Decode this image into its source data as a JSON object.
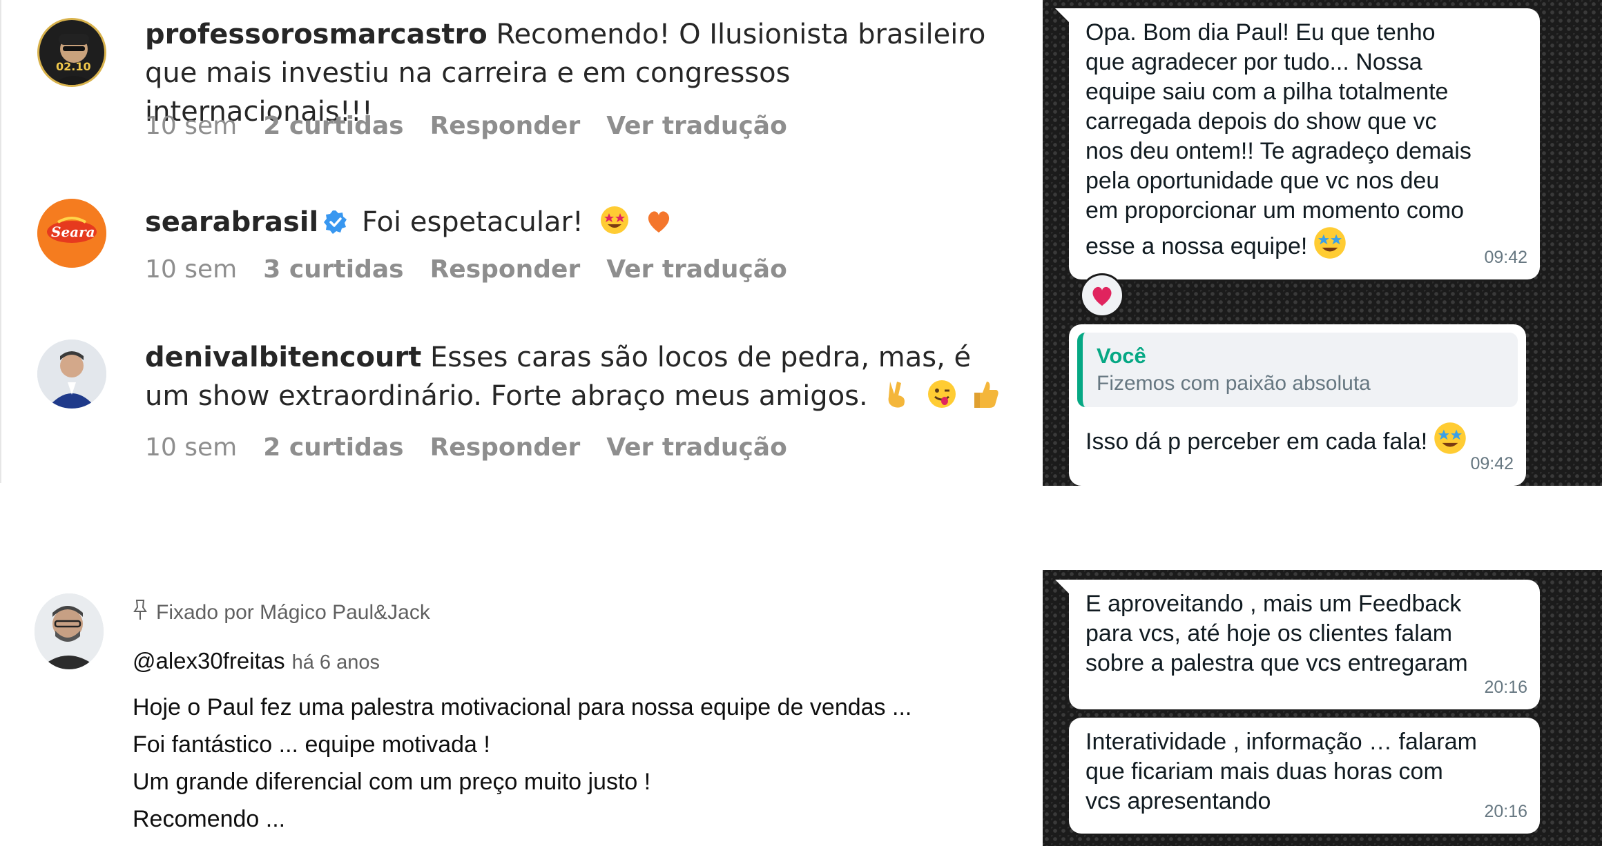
{
  "instagram": {
    "comments": [
      {
        "user": "professorosmarcastro",
        "text": "Recomendo! O Ilusionista brasileiro que mais investiu na carreira e em congressos internacionais!!!",
        "avatar_label": "02.10",
        "time": "10 sem",
        "likes": "2 curtidas",
        "reply": "Responder",
        "translate": "Ver tradução"
      },
      {
        "user": "searabrasil",
        "verified_icon": "verified-badge-icon",
        "text": "Foi espetacular!",
        "avatar_label": "Seara",
        "emojis": [
          "star-struck-emoji",
          "orange-heart-emoji"
        ],
        "time": "10 sem",
        "likes": "3 curtidas",
        "reply": "Responder",
        "translate": "Ver tradução"
      },
      {
        "user": "denivalbitencourt",
        "text": "Esses caras são locos de pedra, mas, é um show extraordinário. Forte abraço meus amigos.",
        "emojis": [
          "victory-hand-emoji",
          "winking-tongue-emoji",
          "thumbs-up-emoji"
        ],
        "time": "10 sem",
        "likes": "2 curtidas",
        "reply": "Responder",
        "translate": "Ver tradução"
      }
    ]
  },
  "youtube": {
    "pinned_label": "Fixado por Mágico Paul&Jack",
    "pin_icon": "pin-icon",
    "user": "@alex30freitas",
    "time": "há 6 anos",
    "lines": [
      "Hoje o Paul fez uma palestra motivacional para nossa equipe de vendas ...",
      "Foi fantástico ... equipe motivada !",
      "Um grande diferencial com um preço muito justo !",
      "Recomendo ..."
    ]
  },
  "whatsapp_top": {
    "message1": {
      "lines": [
        "Opa. Bom dia Paul! Eu que tenho",
        "que agradecer por tudo... Nossa",
        "equipe saiu com a pilha totalmente",
        "carregada depois do show que vc",
        "nos deu ontem!! Te agradeço demais",
        "pela oportunidade que vc nos deu",
        "em proporcionar um momento como",
        "esse a nossa equipe!"
      ],
      "time": "09:42",
      "reaction": "red-heart-emoji"
    },
    "message2": {
      "quote_name": "Você",
      "quote_text": "Fizemos com paixão absoluta",
      "text": "Isso dá p perceber em cada fala!",
      "time": "09:42"
    }
  },
  "whatsapp_bottom": {
    "message1": {
      "lines": [
        "E aproveitando , mais um Feedback",
        "para vcs, até hoje os clientes falam",
        "sobre a palestra que vcs entregaram"
      ],
      "time": "20:16"
    },
    "message2": {
      "lines": [
        "Interatividade , informação … falaram",
        "que ficariam mais duas horas com",
        "vcs apresentando"
      ],
      "time": "20:16"
    }
  },
  "colors": {
    "whatsapp_accent": "#06a884",
    "instagram_meta": "#8e8e8e",
    "verified_blue": "#3897f0",
    "seara_orange": "#f57c1f"
  }
}
